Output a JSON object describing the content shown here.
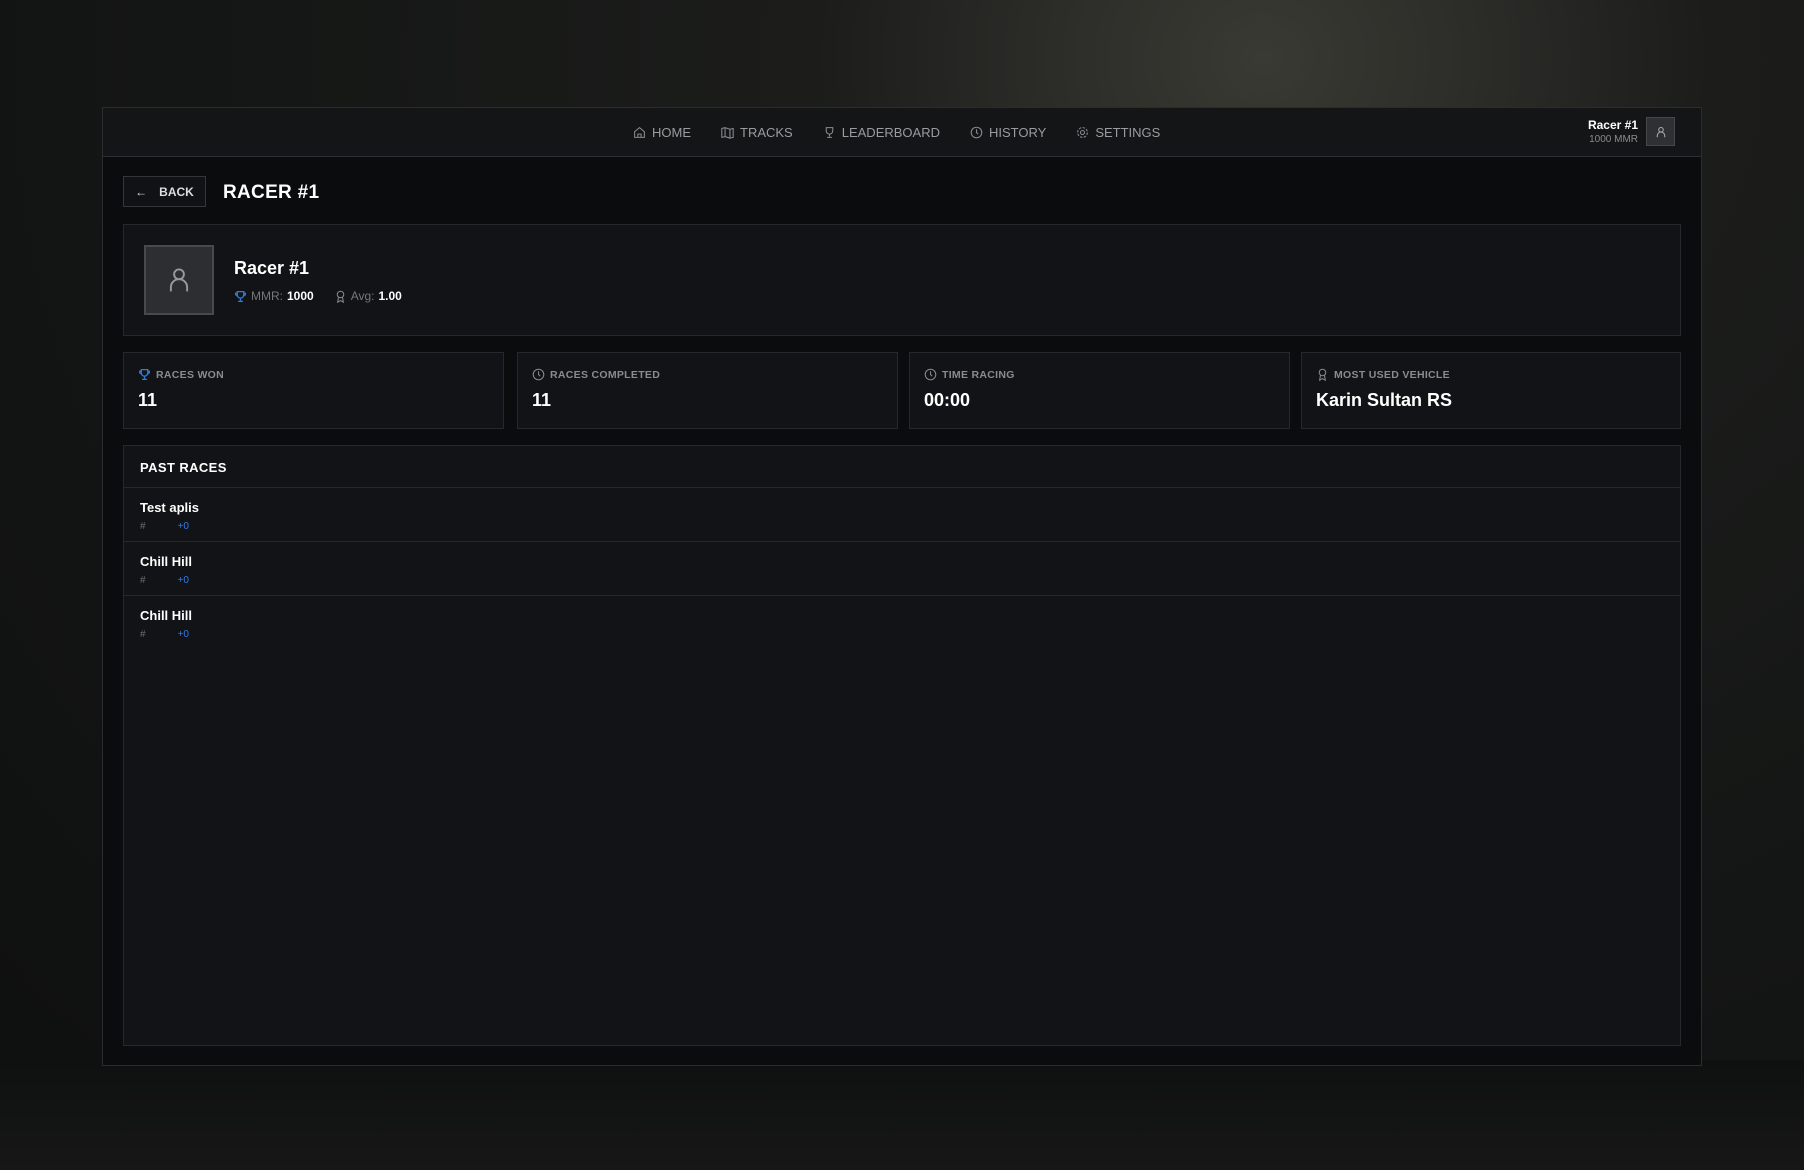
{
  "nav": {
    "items": [
      {
        "label": "HOME",
        "icon": "home-icon"
      },
      {
        "label": "TRACKS",
        "icon": "map-icon"
      },
      {
        "label": "LEADERBOARD",
        "icon": "trophy-icon"
      },
      {
        "label": "HISTORY",
        "icon": "clock-icon"
      },
      {
        "label": "SETTINGS",
        "icon": "gear-icon"
      }
    ],
    "user": {
      "name": "Racer #1",
      "mmr": "1000 MMR"
    }
  },
  "header": {
    "back_label": "BACK",
    "title": "RACER #1"
  },
  "profile": {
    "name": "Racer #1",
    "mmr_label": "MMR:",
    "mmr": "1000",
    "avg_label": "Avg:",
    "avg": "1.00"
  },
  "stats": [
    {
      "label": "RACES WON",
      "value": "11",
      "icon": "trophy-icon"
    },
    {
      "label": "RACES COMPLETED",
      "value": "11",
      "icon": "clock-icon"
    },
    {
      "label": "TIME RACING",
      "value": "00:00",
      "icon": "clock-icon"
    },
    {
      "label": "MOST USED VEHICLE",
      "value": "Karin Sultan RS",
      "icon": "award-icon"
    }
  ],
  "past_races": {
    "title": "PAST RACES",
    "rows": [
      {
        "name": "Test aplis",
        "position": "#",
        "delta": "+0"
      },
      {
        "name": "Chill Hill",
        "position": "#",
        "delta": "+0"
      },
      {
        "name": "Chill Hill",
        "position": "#",
        "delta": "+0"
      }
    ]
  },
  "colors": {
    "accent": "#2f7be6",
    "panel": "#0b0c0e",
    "card": "#121316"
  }
}
